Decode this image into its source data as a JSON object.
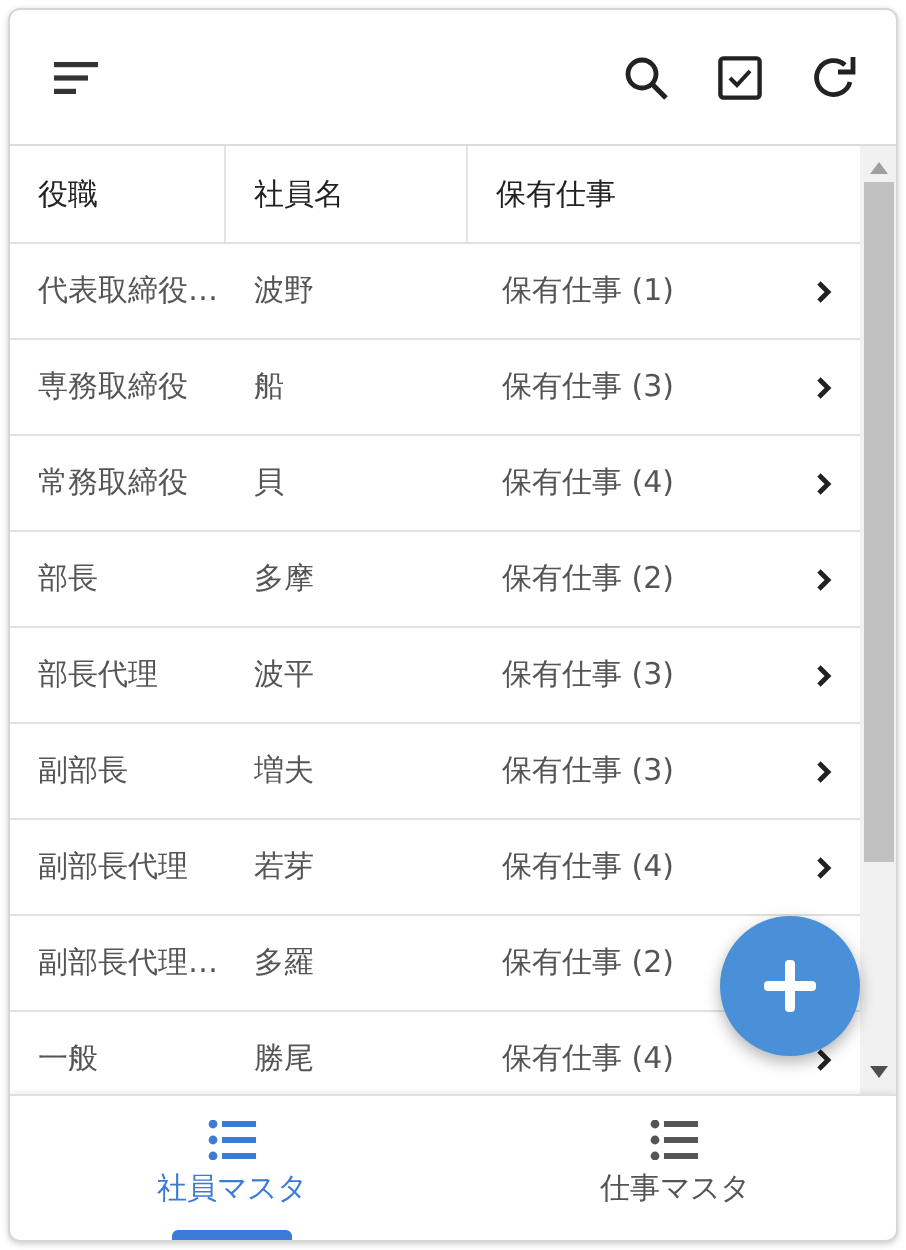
{
  "columns": [
    "役職",
    "社員名",
    "保有仕事"
  ],
  "rows": [
    {
      "role": "代表取締役…",
      "name": "波野",
      "jobs": "保有仕事 (1)",
      "chevron": true
    },
    {
      "role": "専務取締役",
      "name": "船",
      "jobs": "保有仕事 (3)",
      "chevron": true
    },
    {
      "role": "常務取締役",
      "name": "貝",
      "jobs": "保有仕事 (4)",
      "chevron": true
    },
    {
      "role": "部長",
      "name": "多摩",
      "jobs": "保有仕事 (2)",
      "chevron": true
    },
    {
      "role": "部長代理",
      "name": "波平",
      "jobs": "保有仕事 (3)",
      "chevron": true
    },
    {
      "role": "副部長",
      "name": "増夫",
      "jobs": "保有仕事 (3)",
      "chevron": true
    },
    {
      "role": "副部長代理",
      "name": "若芽",
      "jobs": "保有仕事 (4)",
      "chevron": true
    },
    {
      "role": "副部長代理…",
      "name": "多羅",
      "jobs": "保有仕事 (2)",
      "chevron": false
    },
    {
      "role": "一般",
      "name": "勝尾",
      "jobs": "保有仕事 (4)",
      "chevron": true
    }
  ],
  "tabs": [
    {
      "label": "社員マスタ",
      "selected": true
    },
    {
      "label": "仕事マスタ",
      "selected": false
    }
  ]
}
